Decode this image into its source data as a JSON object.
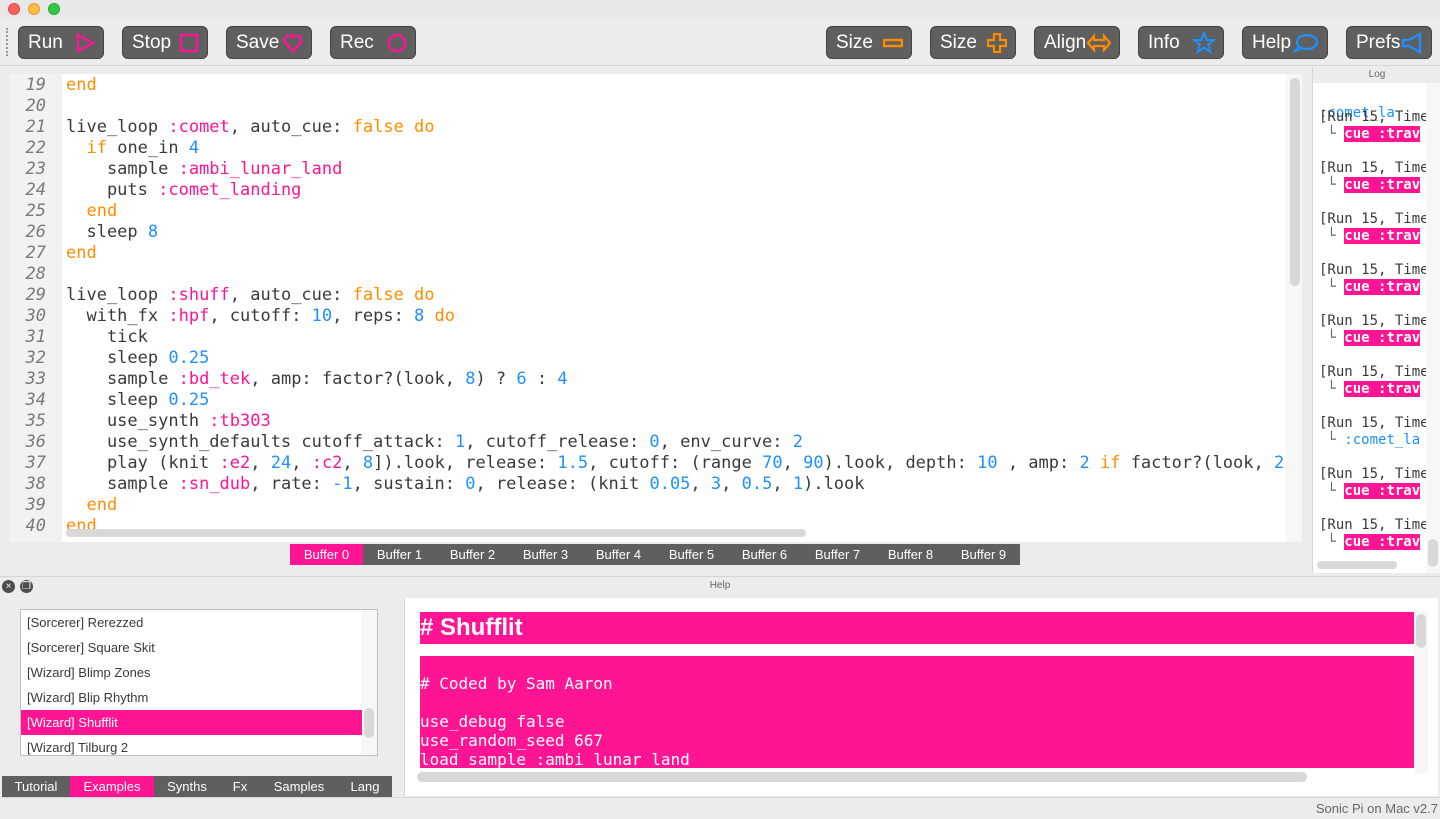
{
  "toolbar": {
    "run": "Run",
    "stop": "Stop",
    "save": "Save",
    "rec": "Rec",
    "size_down": "Size",
    "size_up": "Size",
    "align": "Align",
    "info": "Info",
    "help": "Help",
    "prefs": "Prefs"
  },
  "colors": {
    "accent": "#ff1493",
    "keyword": "#ff8c00",
    "number": "#1e90ff",
    "button": "#5f5f5f"
  },
  "editor": {
    "lines": [
      {
        "n": "19",
        "tokens": [
          [
            "kw",
            "end"
          ]
        ]
      },
      {
        "n": "20",
        "tokens": []
      },
      {
        "n": "21",
        "tokens": [
          [
            "t",
            "live_loop "
          ],
          [
            "sym",
            ":comet"
          ],
          [
            "t",
            ", auto_cue: "
          ],
          [
            "kw",
            "false"
          ],
          [
            "t",
            " "
          ],
          [
            "kw",
            "do"
          ]
        ]
      },
      {
        "n": "22",
        "tokens": [
          [
            "t",
            "  "
          ],
          [
            "kw",
            "if"
          ],
          [
            "t",
            " one_in "
          ],
          [
            "num",
            "4"
          ]
        ]
      },
      {
        "n": "23",
        "tokens": [
          [
            "t",
            "    sample "
          ],
          [
            "sym",
            ":ambi_lunar_land"
          ]
        ]
      },
      {
        "n": "24",
        "tokens": [
          [
            "t",
            "    puts "
          ],
          [
            "sym",
            ":comet_landing"
          ]
        ]
      },
      {
        "n": "25",
        "tokens": [
          [
            "t",
            "  "
          ],
          [
            "kw",
            "end"
          ]
        ]
      },
      {
        "n": "26",
        "tokens": [
          [
            "t",
            "  sleep "
          ],
          [
            "num",
            "8"
          ]
        ]
      },
      {
        "n": "27",
        "tokens": [
          [
            "kw",
            "end"
          ]
        ]
      },
      {
        "n": "28",
        "tokens": []
      },
      {
        "n": "29",
        "tokens": [
          [
            "t",
            "live_loop "
          ],
          [
            "sym",
            ":shuff"
          ],
          [
            "t",
            ", auto_cue: "
          ],
          [
            "kw",
            "false"
          ],
          [
            "t",
            " "
          ],
          [
            "kw",
            "do"
          ]
        ]
      },
      {
        "n": "30",
        "tokens": [
          [
            "t",
            "  with_fx "
          ],
          [
            "sym",
            ":hpf"
          ],
          [
            "t",
            ", cutoff: "
          ],
          [
            "num",
            "10"
          ],
          [
            "t",
            ", reps: "
          ],
          [
            "num",
            "8"
          ],
          [
            "t",
            " "
          ],
          [
            "kw",
            "do"
          ]
        ]
      },
      {
        "n": "31",
        "tokens": [
          [
            "t",
            "    tick"
          ]
        ]
      },
      {
        "n": "32",
        "tokens": [
          [
            "t",
            "    sleep "
          ],
          [
            "num",
            "0.25"
          ]
        ]
      },
      {
        "n": "33",
        "tokens": [
          [
            "t",
            "    sample "
          ],
          [
            "sym",
            ":bd_tek"
          ],
          [
            "t",
            ", amp: factor?(look, "
          ],
          [
            "num",
            "8"
          ],
          [
            "t",
            ") ? "
          ],
          [
            "num",
            "6"
          ],
          [
            "t",
            " : "
          ],
          [
            "num",
            "4"
          ]
        ]
      },
      {
        "n": "34",
        "tokens": [
          [
            "t",
            "    sleep "
          ],
          [
            "num",
            "0.25"
          ]
        ]
      },
      {
        "n": "35",
        "tokens": [
          [
            "t",
            "    use_synth "
          ],
          [
            "sym",
            ":tb303"
          ]
        ]
      },
      {
        "n": "36",
        "tokens": [
          [
            "t",
            "    use_synth_defaults cutoff_attack: "
          ],
          [
            "num",
            "1"
          ],
          [
            "t",
            ", cutoff_release: "
          ],
          [
            "num",
            "0"
          ],
          [
            "t",
            ", env_curve: "
          ],
          [
            "num",
            "2"
          ]
        ]
      },
      {
        "n": "37",
        "tokens": [
          [
            "t",
            "    play (knit "
          ],
          [
            "sym",
            ":e2"
          ],
          [
            "t",
            ", "
          ],
          [
            "num",
            "24"
          ],
          [
            "t",
            ", "
          ],
          [
            "sym",
            ":c2"
          ],
          [
            "t",
            ", "
          ],
          [
            "num",
            "8"
          ],
          [
            "t",
            "]).look, release: "
          ],
          [
            "num",
            "1.5"
          ],
          [
            "t",
            ", cutoff: (range "
          ],
          [
            "num",
            "70"
          ],
          [
            "t",
            ", "
          ],
          [
            "num",
            "90"
          ],
          [
            "t",
            ").look, depth: "
          ],
          [
            "num",
            "10"
          ],
          [
            "t",
            " , amp: "
          ],
          [
            "num",
            "2"
          ],
          [
            "t",
            " "
          ],
          [
            "kw",
            "if"
          ],
          [
            "t",
            " factor?(look, "
          ],
          [
            "num",
            "2"
          ],
          [
            "t",
            ")"
          ]
        ]
      },
      {
        "n": "38",
        "tokens": [
          [
            "t",
            "    sample "
          ],
          [
            "sym",
            ":sn_dub"
          ],
          [
            "t",
            ", rate: "
          ],
          [
            "num",
            "-1"
          ],
          [
            "t",
            ", sustain: "
          ],
          [
            "num",
            "0"
          ],
          [
            "t",
            ", release: (knit "
          ],
          [
            "num",
            "0.05"
          ],
          [
            "t",
            ", "
          ],
          [
            "num",
            "3"
          ],
          [
            "t",
            ", "
          ],
          [
            "num",
            "0.5"
          ],
          [
            "t",
            ", "
          ],
          [
            "num",
            "1"
          ],
          [
            "t",
            ").look"
          ]
        ]
      },
      {
        "n": "39",
        "tokens": [
          [
            "t",
            "  "
          ],
          [
            "kw",
            "end"
          ]
        ]
      },
      {
        "n": "40",
        "tokens": [
          [
            "kw",
            "end"
          ]
        ]
      }
    ]
  },
  "buffers": [
    "Buffer 0",
    "Buffer 1",
    "Buffer 2",
    "Buffer 3",
    "Buffer 4",
    "Buffer 5",
    "Buffer 6",
    "Buffer 7",
    "Buffer 8",
    "Buffer 9"
  ],
  "log": {
    "title": "Log",
    "top_fragment": ":comet_la",
    "entries": [
      {
        "time": "[Run 15, Time",
        "msg": "cue :trav",
        "kind": "cue"
      },
      {
        "time": "[Run 15, Time",
        "msg": "cue :trav",
        "kind": "cue"
      },
      {
        "time": "[Run 15, Time",
        "msg": "cue :trav",
        "kind": "cue"
      },
      {
        "time": "[Run 15, Time",
        "msg": "cue :trav",
        "kind": "cue"
      },
      {
        "time": "[Run 15, Time",
        "msg": "cue :trav",
        "kind": "cue"
      },
      {
        "time": "[Run 15, Time",
        "msg": "cue :trav",
        "kind": "cue"
      },
      {
        "time": "[Run 15, Time",
        "msg": ":comet_la",
        "kind": "sym"
      },
      {
        "time": "[Run 15, Time",
        "msg": "cue :trav",
        "kind": "cue"
      },
      {
        "time": "[Run 15, Time",
        "msg": "cue :trav",
        "kind": "cue"
      }
    ]
  },
  "help": {
    "title": "Help",
    "examples": [
      "[Sorcerer] Rerezzed",
      "[Sorcerer] Square Skit",
      "[Wizard] Blimp Zones",
      "[Wizard] Blip Rhythm",
      "[Wizard] Shufflit",
      "[Wizard] Tilburg 2"
    ],
    "tabs": [
      "Tutorial",
      "Examples",
      "Synths",
      "Fx",
      "Samples",
      "Lang"
    ],
    "doc_heading": "# Shufflit",
    "doc_lines": [
      "# Coded by Sam Aaron",
      "",
      "use_debug false",
      "use_random_seed 667",
      "load_sample :ambi_lunar_land"
    ]
  },
  "status": "Sonic Pi on Mac v2.7"
}
